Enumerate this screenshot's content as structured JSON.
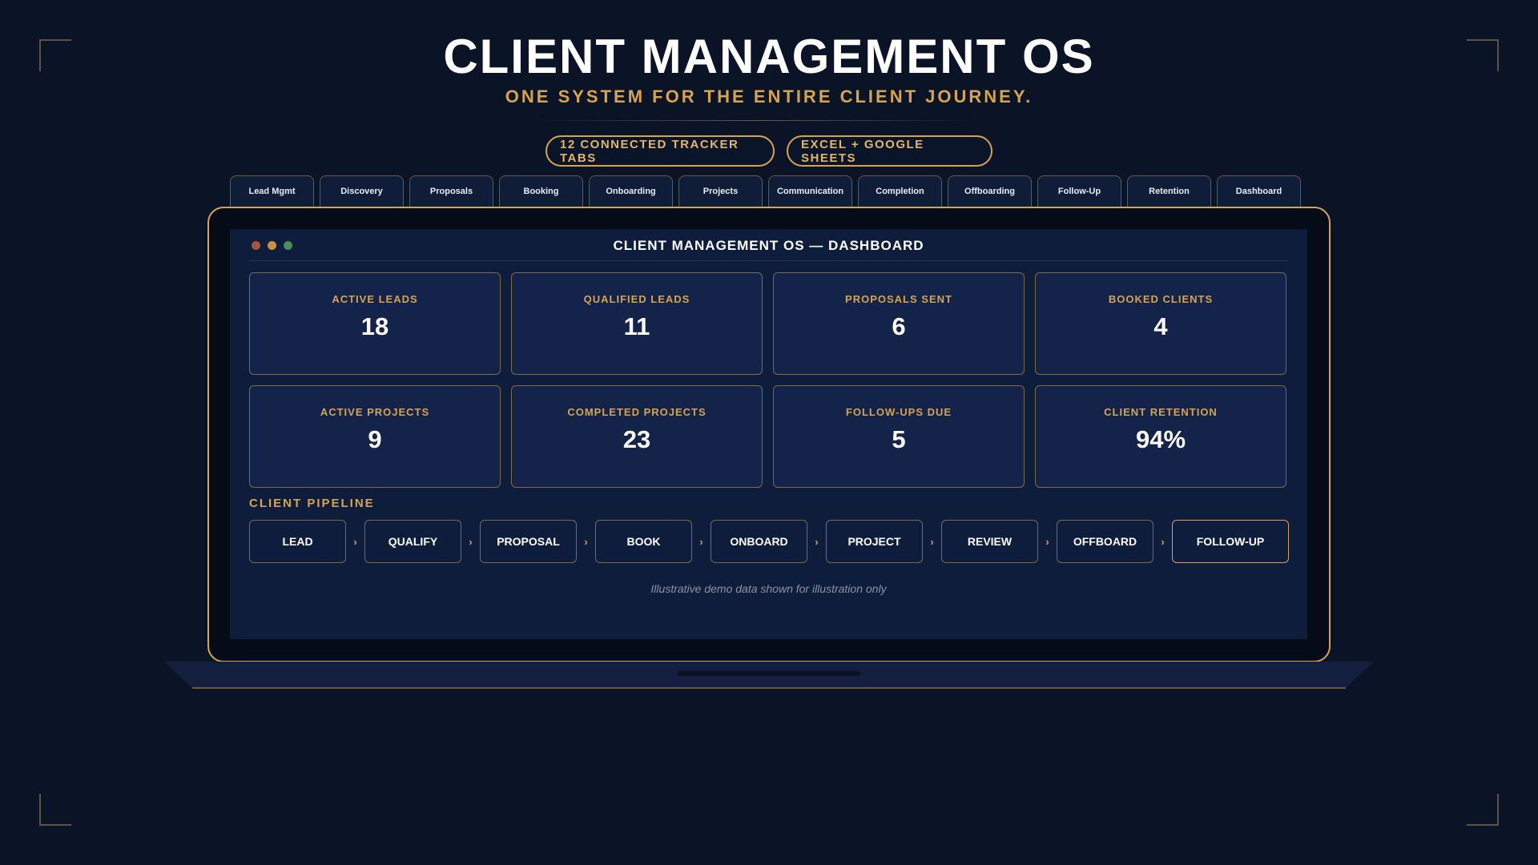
{
  "hero": {
    "title": "CLIENT MANAGEMENT OS",
    "subtitle": "ONE SYSTEM FOR THE ENTIRE CLIENT JOURNEY.",
    "badges": [
      "12 CONNECTED TRACKER TABS",
      "EXCEL + GOOGLE SHEETS"
    ]
  },
  "tabs": [
    "Lead Mgmt",
    "Discovery",
    "Proposals",
    "Booking",
    "Onboarding",
    "Projects",
    "Communication",
    "Completion",
    "Offboarding",
    "Follow-Up",
    "Retention",
    "Dashboard"
  ],
  "dashboard": {
    "window_title": "CLIENT MANAGEMENT OS — DASHBOARD",
    "metrics": [
      {
        "label": "ACTIVE LEADS",
        "value": "18"
      },
      {
        "label": "QUALIFIED LEADS",
        "value": "11"
      },
      {
        "label": "PROPOSALS SENT",
        "value": "6"
      },
      {
        "label": "BOOKED CLIENTS",
        "value": "4"
      },
      {
        "label": "ACTIVE PROJECTS",
        "value": "9"
      },
      {
        "label": "COMPLETED PROJECTS",
        "value": "23"
      },
      {
        "label": "FOLLOW-UPS DUE",
        "value": "5"
      },
      {
        "label": "CLIENT RETENTION",
        "value": "94%"
      }
    ],
    "pipeline_title": "CLIENT PIPELINE",
    "pipeline": [
      "LEAD",
      "QUALIFY",
      "PROPOSAL",
      "BOOK",
      "ONBOARD",
      "PROJECT",
      "REVIEW",
      "OFFBOARD",
      "FOLLOW-UP"
    ],
    "arrow_glyph": "›",
    "note": "Illustrative demo data shown for illustration only"
  },
  "colors": {
    "background": "#0b1426",
    "accent_gold": "#d6a450",
    "screen": "#0f1d3c",
    "card": "#13234a",
    "window_dots": [
      "#a0593f",
      "#c9903f",
      "#4e8a5c"
    ]
  }
}
